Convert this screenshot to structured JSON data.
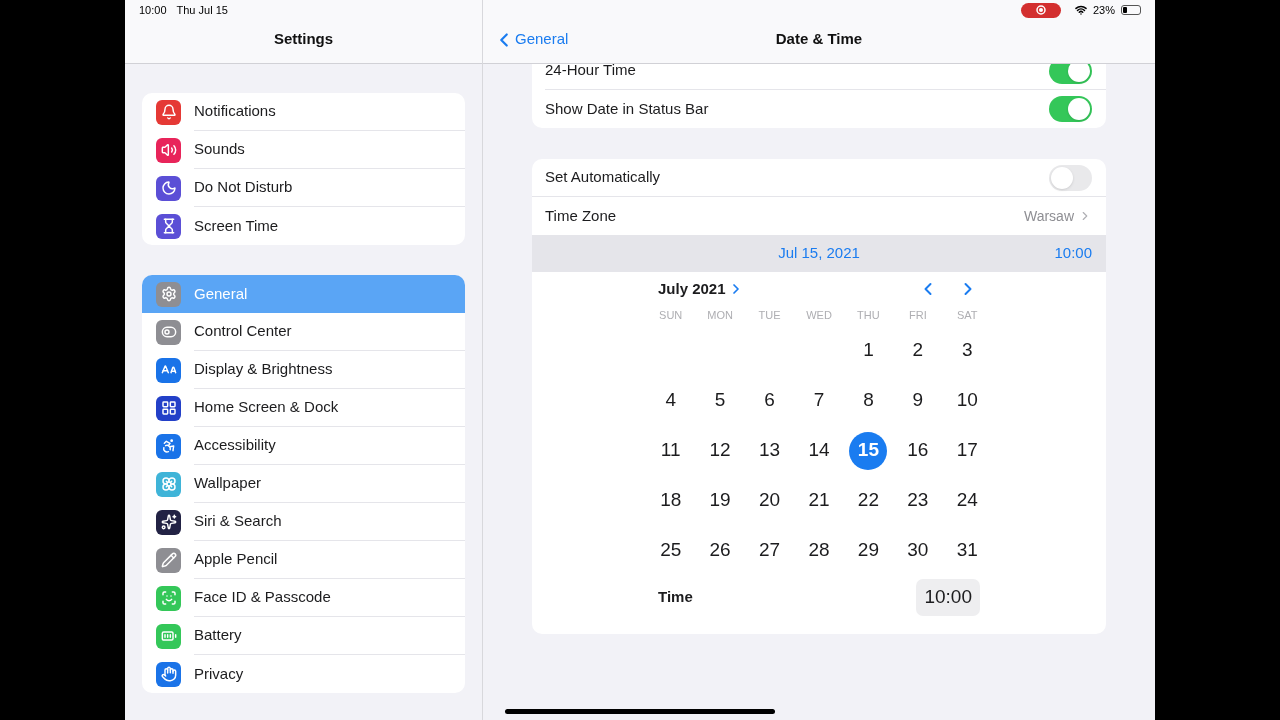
{
  "status_bar": {
    "time": "10:00",
    "date": "Thu Jul 15",
    "recording": true,
    "battery_text": "23%",
    "battery": {
      "level": 0.23
    }
  },
  "sidebar": {
    "title": "Settings",
    "groups": [
      {
        "items": [
          {
            "label": "Notifications",
            "kind": "notifications",
            "color": "#e53935",
            "selected": false
          },
          {
            "label": "Sounds",
            "kind": "sounds",
            "color": "#e8245a",
            "selected": false
          },
          {
            "label": "Do Not Disturb",
            "kind": "moon",
            "color": "#5b4fd6",
            "selected": false
          },
          {
            "label": "Screen Time",
            "kind": "hourglass",
            "color": "#5b4fd6",
            "selected": false
          }
        ]
      },
      {
        "items": [
          {
            "label": "General",
            "kind": "gear",
            "color": "#8e8e93",
            "selected": true
          },
          {
            "label": "Control Center",
            "kind": "toggles",
            "color": "#8e8e93",
            "selected": false
          },
          {
            "label": "Display & Brightness",
            "kind": "text",
            "color": "#1a73e8",
            "selected": false
          },
          {
            "label": "Home Screen & Dock",
            "kind": "grid",
            "color": "#2340c8",
            "selected": false
          },
          {
            "label": "Accessibility",
            "kind": "accessibility",
            "color": "#1a73e8",
            "selected": false
          },
          {
            "label": "Wallpaper",
            "kind": "flower",
            "color": "#3fb4d8",
            "selected": false
          },
          {
            "label": "Siri & Search",
            "kind": "siri",
            "color": "#222244",
            "selected": false
          },
          {
            "label": "Apple Pencil",
            "kind": "pencil",
            "color": "#8e8e93",
            "selected": false
          },
          {
            "label": "Face ID & Passcode",
            "kind": "faceid",
            "color": "#34c759",
            "selected": false
          },
          {
            "label": "Battery",
            "kind": "battery",
            "color": "#34c759",
            "selected": false
          },
          {
            "label": "Privacy",
            "kind": "hand",
            "color": "#1a73e8",
            "selected": false
          }
        ]
      }
    ]
  },
  "detail": {
    "back": "General",
    "title": "Date & Time",
    "format_group": [
      {
        "label": "24-Hour Time",
        "on": true
      },
      {
        "label": "Show Date in Status Bar",
        "on": true
      }
    ],
    "set_automatically": {
      "label": "Set Automatically",
      "on": false
    },
    "time_zone": {
      "label": "Time Zone",
      "value": "Warsaw"
    },
    "selected_date": "Jul 15, 2021",
    "selected_time": "10:00",
    "calendar": {
      "month": "July 2021",
      "weekdays": [
        "SUN",
        "MON",
        "TUE",
        "WED",
        "THU",
        "FRI",
        "SAT"
      ],
      "weeks": [
        [
          {
            "day": "1",
            "selected": false
          },
          {
            "day": "2",
            "selected": false
          },
          {
            "day": "3",
            "selected": false
          }
        ],
        [
          {
            "day": "4",
            "selected": false
          },
          {
            "day": "5",
            "selected": false
          },
          {
            "day": "6",
            "selected": false
          },
          {
            "day": "7",
            "selected": false
          },
          {
            "day": "8",
            "selected": false
          },
          {
            "day": "9",
            "selected": false
          },
          {
            "day": "10",
            "selected": false
          }
        ],
        [
          {
            "day": "11",
            "selected": false
          },
          {
            "day": "12",
            "selected": false
          },
          {
            "day": "13",
            "selected": false
          },
          {
            "day": "14",
            "selected": false
          },
          {
            "day": "15",
            "selected": true
          },
          {
            "day": "16",
            "selected": false
          },
          {
            "day": "17",
            "selected": false
          }
        ],
        [
          {
            "day": "18",
            "selected": false
          },
          {
            "day": "19",
            "selected": false
          },
          {
            "day": "20",
            "selected": false
          },
          {
            "day": "21",
            "selected": false
          },
          {
            "day": "22",
            "selected": false
          },
          {
            "day": "23",
            "selected": false
          },
          {
            "day": "24",
            "selected": false
          }
        ],
        [
          {
            "day": "25",
            "selected": false
          },
          {
            "day": "26",
            "selected": false
          },
          {
            "day": "27",
            "selected": false
          },
          {
            "day": "28",
            "selected": false
          },
          {
            "day": "29",
            "selected": false
          },
          {
            "day": "30",
            "selected": false
          },
          {
            "day": "31",
            "selected": false
          }
        ]
      ]
    },
    "time_label": "Time",
    "time_value": "10:00"
  }
}
